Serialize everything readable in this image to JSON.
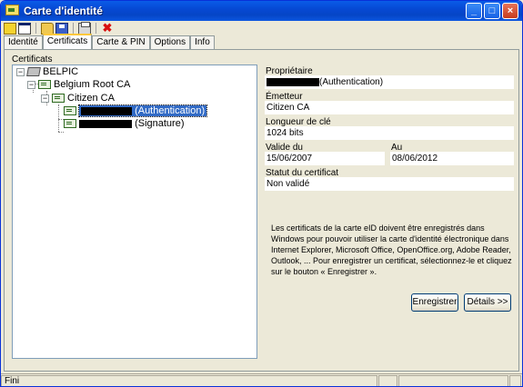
{
  "window": {
    "title": "Carte d'identité"
  },
  "tabs": [
    {
      "label": "Identité"
    },
    {
      "label": "Certificats"
    },
    {
      "label": "Carte & PIN"
    },
    {
      "label": "Options"
    },
    {
      "label": "Info"
    }
  ],
  "certificates": {
    "group_label": "Certificats",
    "tree": {
      "root": "BELPIC",
      "ca_root": "Belgium Root CA",
      "ca": "Citizen CA",
      "auth": "(Authentication)",
      "sign": "(Signature)"
    }
  },
  "details": {
    "owner_label": "Propriétaire",
    "owner_value": "(Authentication)",
    "issuer_label": "Émetteur",
    "issuer_value": "Citizen CA",
    "keylen_label": "Longueur de clé",
    "keylen_value": "1024 bits",
    "valid_from_label": "Valide du",
    "valid_from_value": "15/06/2007",
    "valid_to_label": "Au",
    "valid_to_value": "08/06/2012",
    "status_label": "Statut du certificat",
    "status_value": "Non validé",
    "info_text": "Les certificats de la carte eID doivent être enregistrés dans Windows pour pouvoir utiliser la carte d'identité électronique dans Internet Explorer, Microsoft Office, OpenOffice.org, Adobe Reader, Outlook, ... Pour enregistrer un certificat, sélectionnez-le et cliquez sur le bouton « Enregistrer »."
  },
  "buttons": {
    "register": "Enregistrer",
    "details": "Détails >>"
  },
  "status": {
    "text": "Fini"
  }
}
